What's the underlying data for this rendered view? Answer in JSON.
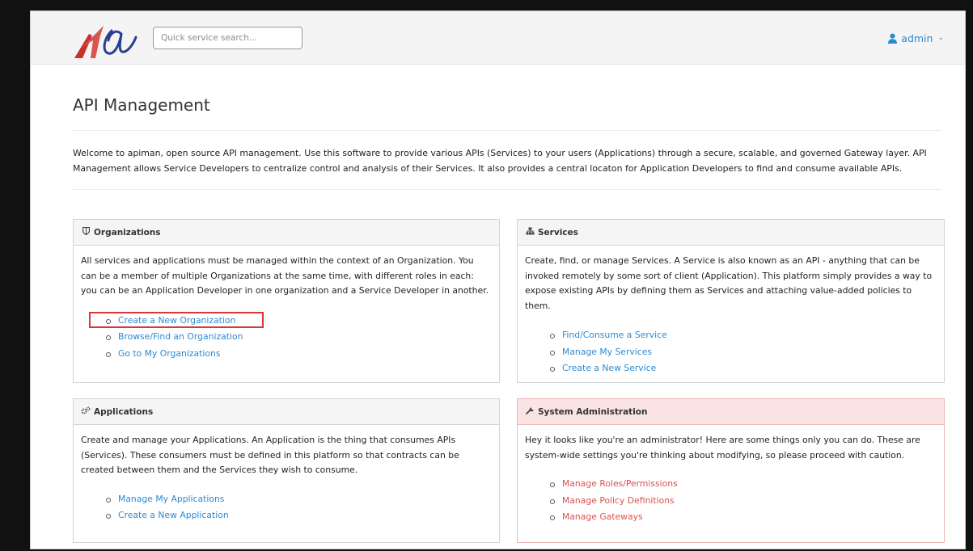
{
  "header": {
    "search_placeholder": "Quick service search...",
    "user_name": "admin"
  },
  "page": {
    "title": "API Management",
    "welcome": "Welcome to apiman, open source API management. Use this software to provide various APIs (Services) to your users (Applications) through a secure, scalable, and governed Gateway layer. API Management allows Service Developers to centralize control and analysis of their Services. It also provides a central locaton for Application Developers to find and consume available APIs."
  },
  "panels": {
    "organizations": {
      "title": "Organizations",
      "icon": "shield-icon",
      "text": "All services and applications must be managed within the context of an Organization. You can be a member of multiple Organizations at the same time, with different roles in each: you can be an Application Developer in one organization and a Service Developer in another.",
      "links": [
        "Create a New Organization",
        "Browse/Find an Organization",
        "Go to My Organizations"
      ]
    },
    "services": {
      "title": "Services",
      "icon": "sitemap-icon",
      "text": "Create, find, or manage Services. A Service is also known as an API - anything that can be invoked remotely by some sort of client (Application). This platform simply provides a way to expose existing APIs by defining them as Services and attaching value-added policies to them.",
      "links": [
        "Find/Consume a Service",
        "Manage My Services",
        "Create a New Service"
      ]
    },
    "applications": {
      "title": "Applications",
      "icon": "gears-icon",
      "text": "Create and manage your Applications. An Application is the thing that consumes APIs (Services). These consumers must be defined in this platform so that contracts can be created between them and the Services they wish to consume.",
      "links": [
        "Manage My Applications",
        "Create a New Application"
      ]
    },
    "admin": {
      "title": "System Administration",
      "icon": "wrench-icon",
      "text": "Hey it looks like you're an administrator! Here are some things only you can do. These are system-wide settings you're thinking about modifying, so please proceed with caution.",
      "links": [
        "Manage Roles/Permissions",
        "Manage Policy Definitions",
        "Manage Gateways"
      ]
    }
  },
  "colors": {
    "link": "#2b8ad1",
    "danger_link": "#d9534f",
    "danger_panel_bg": "#fbe3e3",
    "highlight_box": "#d9373a"
  }
}
